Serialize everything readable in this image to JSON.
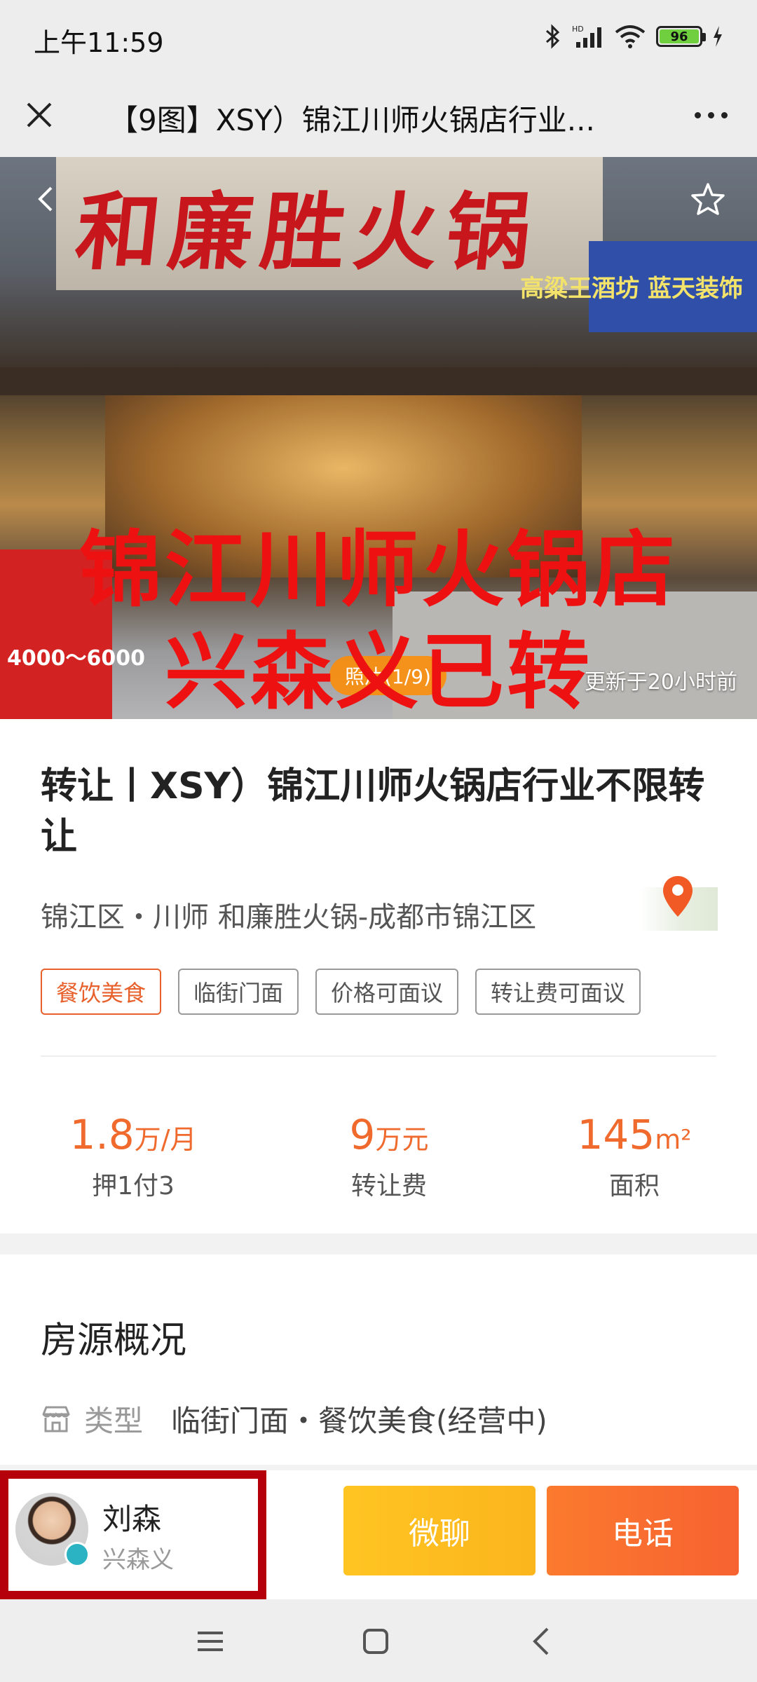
{
  "status_bar": {
    "time": "上午11:59",
    "battery": "96"
  },
  "title_bar": {
    "title": "【9图】XSY）锦江川师火锅店行业..."
  },
  "hero": {
    "sign_text": "和廉胜火锅",
    "blue_sign_text": "高粱王酒坊 蓝天装饰",
    "poster_text": "4000～6000",
    "overlay_line1": "锦江川师火锅店",
    "overlay_line2": "兴森义已转",
    "photo_count": "照片(1/9)",
    "update_time": "更新于20小时前"
  },
  "listing": {
    "title": "转让丨XSY）锦江川师火锅店行业不限转让",
    "location": "锦江区・川师 和廉胜火锅-成都市锦江区",
    "tags": [
      "餐饮美食",
      "临街门面",
      "价格可面议",
      "转让费可面议"
    ]
  },
  "stats": [
    {
      "value": "1.8",
      "unit": "万/月",
      "label": "押1付3"
    },
    {
      "value": "9",
      "unit": "万元",
      "label": "转让费"
    },
    {
      "value": "145",
      "unit": "m²",
      "label": "面积"
    }
  ],
  "overview": {
    "title": "房源概况",
    "type_label": "类型",
    "type_value": "临街门面・餐饮美食(经营中)"
  },
  "agent": {
    "name": "刘森",
    "company": "兴森义"
  },
  "actions": {
    "chat": "微聊",
    "call": "电话"
  },
  "colors": {
    "accent": "#ef6a2c",
    "chat": "#ffc422",
    "call": "#f76231",
    "highlight_border": "#b5000c"
  }
}
